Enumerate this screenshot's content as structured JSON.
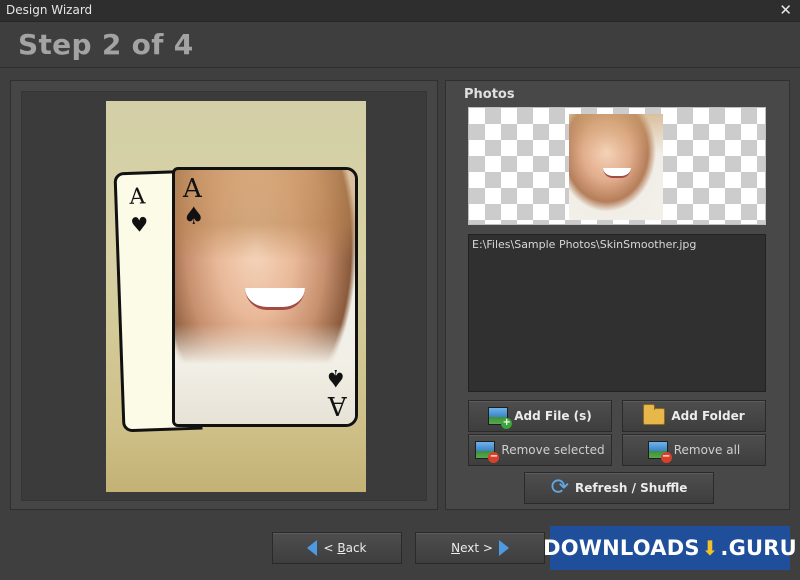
{
  "window": {
    "title": "Design Wizard",
    "close_glyph": "✕"
  },
  "header": {
    "step_text": "Step 2 of 4"
  },
  "preview_card": {
    "back_rank": "A",
    "back_suit": "♥",
    "front_rank": "A",
    "front_suit": "♠"
  },
  "photos": {
    "section_title": "Photos",
    "files": [
      "E:\\Files\\Sample Photos\\SkinSmoother.jpg"
    ],
    "buttons": {
      "add_files": "Add File (s)",
      "add_folder": "Add Folder",
      "remove_selected": "Remove selected",
      "remove_all": "Remove all",
      "refresh_shuffle": "Refresh / Shuffle"
    }
  },
  "nav": {
    "back_prefix": "< ",
    "back_underlined": "B",
    "back_rest": "ack",
    "next_underlined": "N",
    "next_rest": "ext >"
  },
  "watermark": {
    "left": "DOWNLOADS",
    "right": ".GURU",
    "brand_color": "#1f4e9a",
    "accent_color": "#f2c027"
  },
  "icons": {
    "add_files": "image-add-icon",
    "add_folder": "folder-icon",
    "remove_selected": "image-remove-icon",
    "remove_all": "image-remove-icon",
    "refresh": "refresh-icon",
    "back": "arrow-left-icon",
    "next": "arrow-right-icon"
  }
}
